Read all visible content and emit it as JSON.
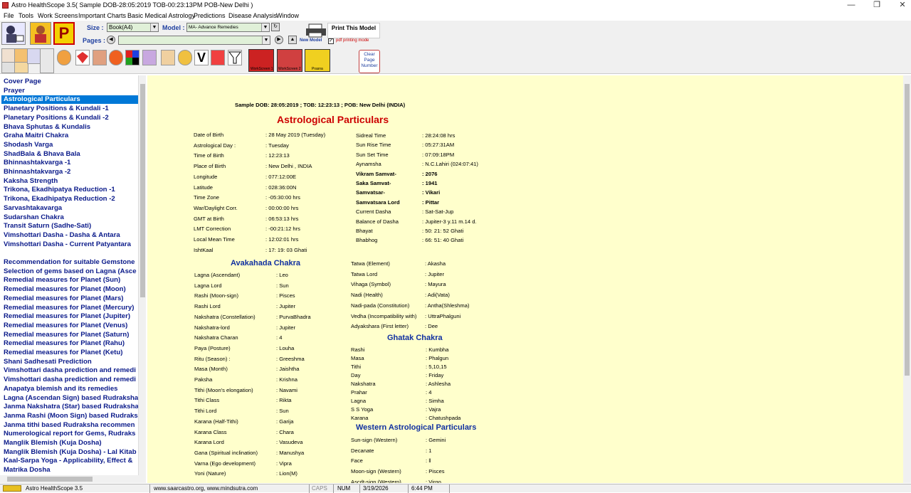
{
  "window": {
    "title": "Astro HealthScope 3.5( Sample DOB-28:05:2019 TOB-00:23:13PM POB-New Delhi )",
    "controls": [
      "—",
      "❐",
      "✕"
    ]
  },
  "menu": [
    "File",
    "Tools",
    "Work Screens",
    "Important Charts",
    "Basic Medical Astrology",
    "Predictions",
    "Disease Analysis",
    "Window"
  ],
  "toolbar": {
    "size_label": "Size :",
    "size_value": "Book(A4)",
    "model_label": "Model :",
    "model_value": "MA- Advance Remedies",
    "pages_label": "Pages :",
    "pages_value": "",
    "print_label": "Print This Model",
    "new_model_label": "New Model",
    "pdf_label": "pdf printing mode",
    "pdf_checked": true,
    "clear_page_label": "Clear Page Number",
    "ws1_label": "WorkScreen 1",
    "ws2_label": "WorkScreen 2",
    "prasna_label": "Prasna",
    "p_icon": "P"
  },
  "sidebar": {
    "items": [
      "Cover Page",
      "Prayer",
      "Astrological Particulars",
      "Planetary Positions & Kundali -1",
      "Planetary Positions & Kundali -2",
      "Bhava Sphutas & Kundalis",
      "Graha Maitri Chakra",
      "Shodash Varga",
      "ShadBala & Bhava Bala",
      "Bhinnashtakvarga -1",
      "Bhinnashtakvarga -2",
      "Kaksha Strength",
      "Trikona, Ekadhipatya Reduction -1",
      "Trikona, Ekadhipatya Reduction -2",
      "Sarvashtakavarga",
      "Sudarshan Chakra",
      "Transit Saturn (Sadhe-Sati)",
      "Vimshottari Dasha - Dasha & Antara",
      "Vimshottari Dasha - Current Patyantara",
      "",
      "Recommendation for suitable Gemstone",
      "Selection of gems based on Lagna (Asce",
      "Remedial measures for Planet (Sun)",
      "Remedial measures for Planet (Moon)",
      "Remedial measures for Planet (Mars)",
      "Remedial measures for Planet (Mercury)",
      "Remedial measures for Planet (Jupiter)",
      "Remedial measures for Planet (Venus)",
      "Remedial measures for Planet (Saturn)",
      "Remedial measures for Planet (Rahu)",
      "Remedial measures for Planet (Ketu)",
      "Shani Sadhesati Prediction",
      "Vimshottari dasha prediction and remedi",
      "Vimshottari dasha prediction and remedi",
      "Anapatya blemish and its remedies",
      "Lagna (Ascendan Sign) based Rudraksha",
      "Janma Nakshatra (Star) based Rudraksha",
      "Janma Rashi (Moon Sign) based Rudraks",
      "Janma tithi based Rudraksha recommen",
      "Numerological report for Gems, Rudraks",
      "Manglik Blemish (Kuja Dosha)",
      "Manglik Blemish (Kuja Dosha) - Lal Kitab",
      "Kaal-Sarpa Yoga - Applicability, Effect &",
      "Matrika Dosha"
    ],
    "selected_index": 2
  },
  "report": {
    "header": "Sample  DOB: 28:05:2019 ; TOB: 12:23:13 ; POB: New Delhi (INDIA)",
    "title": "Astrological Particulars",
    "birth_left": [
      [
        "Date of Birth",
        ": 28 May 2019 (Tuesday)"
      ],
      [
        "Astrological Day :",
        ": Tuesday"
      ],
      [
        "Time of Birth",
        ": 12:23:13"
      ],
      [
        "Place of Birth",
        ": New Delhi , INDIA"
      ],
      [
        "Longitude",
        ": 077:12:00E"
      ],
      [
        "Latitude",
        ": 028:36:00N"
      ],
      [
        "Time Zone",
        ": -05:30:00 hrs"
      ],
      [
        "War/Daylight Corr.",
        ": 00:00:00 hrs"
      ],
      [
        "GMT at Birth",
        ": 06:53:13 hrs"
      ],
      [
        "LMT Correction",
        ": -00:21:12 hrs"
      ],
      [
        "Local Mean Time",
        ": 12:02:01 hrs"
      ],
      [
        "IshtKaal",
        ": 17: 19: 03 Ghati"
      ]
    ],
    "birth_right": [
      [
        "Sidreal Time",
        ": 28:24:08 hrs",
        false
      ],
      [
        "Sun Rise Time",
        ": 05:27:31AM",
        false
      ],
      [
        "Sun Set Time",
        ": 07:09:18PM",
        false
      ],
      [
        "Aynamsha",
        ": N.C.Lahiri (024:07:41)",
        false
      ],
      [
        "Vikram Samvat-",
        ": 2076",
        true
      ],
      [
        "Saka Samvat-",
        ": 1941",
        true
      ],
      [
        "Samvatsar-",
        ": Vikari",
        true
      ],
      [
        "Samvatsara Lord",
        ": Pittar",
        true
      ],
      [
        "Current Dasha",
        ": Sat-Sat-Jup",
        false
      ],
      [
        "Balance of Dasha",
        ": Jupiter-3 y.11 m.14 d.",
        false
      ],
      [
        "Bhayat",
        ": 50: 21: 52 Ghati",
        false
      ],
      [
        "Bhabhog",
        ": 66: 51: 40 Ghati",
        false
      ]
    ],
    "avakahada_title": "Avakahada Chakra",
    "avakahada": [
      [
        "Lagna (Ascendant)",
        ": Leo"
      ],
      [
        "Lagna Lord",
        ": Sun"
      ],
      [
        "Rashi (Moon-sign)",
        ": Pisces"
      ],
      [
        "Rashi Lord",
        ": Jupiter"
      ],
      [
        "Nakshatra (Constellation)",
        ": PurvaBhadra"
      ],
      [
        "Nakshatra-lord",
        ": Jupiter"
      ],
      [
        "Nakshatra Charan",
        ": 4"
      ],
      [
        "Paya (Posture)",
        ": Louha"
      ],
      [
        "Ritu (Season) :",
        ": Greeshma"
      ],
      [
        "Masa (Month)",
        ": Jaishtha"
      ],
      [
        "Paksha",
        ": Krishna"
      ],
      [
        "Tithi (Moon's elongation)",
        ": Navami"
      ],
      [
        "Tithi Class",
        ": Rikta"
      ],
      [
        "Tithi Lord",
        ": Sun"
      ],
      [
        "Karana (Half-Tithi)",
        ": Garija"
      ],
      [
        "Karana Class",
        ": Chara"
      ],
      [
        "Karana Lord",
        ": Vasudeva"
      ],
      [
        "Gana (Spiritual inclination)",
        ": Manushya"
      ],
      [
        "Varna (Ego development)",
        ": Vipra"
      ],
      [
        "Yoni (Nature)",
        ": Lion(M)"
      ]
    ],
    "tatwa": [
      [
        "Tatwa (Element)",
        ": Akasha"
      ],
      [
        "Tatwa Lord",
        ": Jupiter"
      ],
      [
        "Vihaga (Symbol)",
        ": Mayura"
      ],
      [
        "Nadi (Health)",
        ": Adi(Vata)"
      ],
      [
        "Nadi-pada (Constitution)",
        ": Antha(Shleshma)"
      ],
      [
        "Vedha (Incompatibility with)",
        ": UttraPhalguni"
      ],
      [
        "Adyakshara (First letter)",
        ": Dee"
      ]
    ],
    "ghatak_title": "Ghatak Chakra",
    "ghatak": [
      [
        "Rashi",
        ": Kumbha"
      ],
      [
        "Masa",
        ": Phalgun"
      ],
      [
        "Tithi",
        ": 5,10,15"
      ],
      [
        "Day",
        ": Friday"
      ],
      [
        "Nakshatra",
        ": Ashlesha"
      ],
      [
        "Prahar",
        ": 4"
      ],
      [
        "Lagna",
        ": Simha"
      ],
      [
        "S S Yoga",
        ": Vajra"
      ],
      [
        "Karana",
        ": Chatushpada"
      ]
    ],
    "western_title": "Western Astrological Particulars",
    "western": [
      [
        "Sun-sign (Western)",
        ": Gemini"
      ],
      [
        "Decanate",
        ": 1"
      ],
      [
        "Face",
        ": ‖"
      ],
      [
        "Moon-sign (Western)",
        ": Pisces"
      ],
      [
        "Ascdt-sign (Western)",
        ": Virgo"
      ]
    ]
  },
  "status": {
    "app": "Astro HealthScope 3.5",
    "url": "www.saarcastro.org, www.mindsutra.com",
    "caps": "CAPS",
    "num": "NUM",
    "date": "3/19/2026",
    "time": "6:44 PM"
  },
  "colors": {
    "content_bg": "#ffffcc",
    "heading_red": "#cc0000",
    "heading_blue": "#1030a0",
    "sidebar_text": "#0a1a8a",
    "selection": "#0078d7"
  }
}
